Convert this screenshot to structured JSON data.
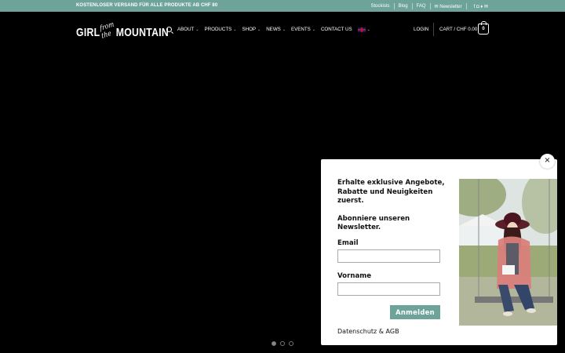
{
  "topbar": {
    "promo": "KOSTENLOSER VERSAND FÜR ALLE PRODUKTE AB CHF 80",
    "links": [
      "Stockists",
      "Blog",
      "FAQ"
    ],
    "newsletter": "Newsletter",
    "bg_color": "#6da39a"
  },
  "header": {
    "logo_left": "GIRL",
    "logo_script_1": "from",
    "logo_script_2": "the",
    "logo_right": "MOUNTAIN",
    "nav": [
      "ABOUT",
      "PRODUCTS",
      "SHOP",
      "NEWS",
      "EVENTS",
      "CONTACT US"
    ],
    "login": "LOGIN",
    "cart": "CART / CHF 0.00",
    "cart_count": "0"
  },
  "slider": {
    "dot_count": 3,
    "active_index": 0
  },
  "popup": {
    "headline": "Erhalte exklusive Angebote, Rabatte und Neuigkeiten zuerst.",
    "subheadline": "Abonniere unseren Newsletter.",
    "email_label": "Email",
    "email_value": "",
    "firstname_label": "Vorname",
    "firstname_value": "",
    "submit_label": "Anmelden",
    "privacy": "Datenschutz & AGB",
    "close_glyph": "×",
    "accent_color": "#6da39a"
  }
}
